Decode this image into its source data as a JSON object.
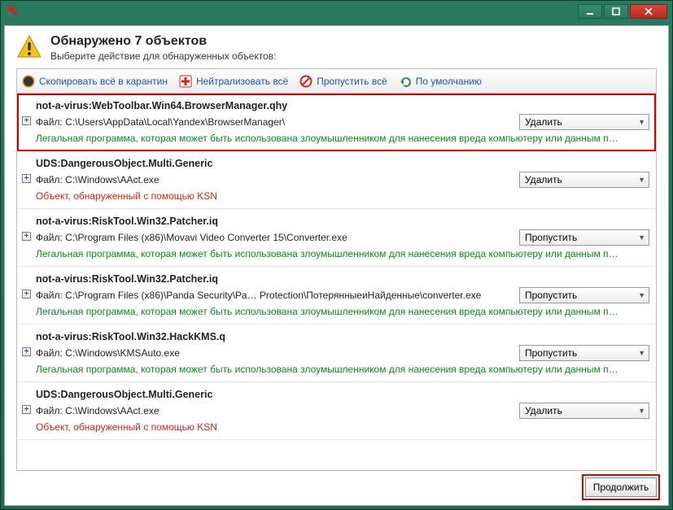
{
  "header": {
    "title": "Обнаружено 7 объектов",
    "subtitle": "Выберите действие для обнаруженных объектов:"
  },
  "toolbar": {
    "quarantine": "Скопировать всё в карантин",
    "neutralize": "Нейтрализовать всё",
    "skip": "Пропустить всё",
    "default": "По умолчанию"
  },
  "labels": {
    "file_prefix": "Файл: "
  },
  "items": [
    {
      "name": "not-a-virus:WebToolbar.Win64.BrowserManager.qhy",
      "path": "C:\\Users\\AppData\\Local\\Yandex\\BrowserManager\\",
      "action": "Удалить",
      "desc": "Легальная программа, которая может быть использована злоумышленником для нанесения вреда компьютеру или данным п…",
      "desc_color": "green",
      "highlight": true
    },
    {
      "name": "UDS:DangerousObject.Multi.Generic",
      "path": "C:\\Windows\\AAct.exe",
      "action": "Удалить",
      "desc": "Объект, обнаруженный с помощью KSN",
      "desc_color": "red",
      "highlight": false
    },
    {
      "name": "not-a-virus:RiskTool.Win32.Patcher.iq",
      "path": "C:\\Program Files (x86)\\Movavi Video Converter 15\\Converter.exe",
      "action": "Пропустить",
      "desc": "Легальная программа, которая может быть использована злоумышленником для нанесения вреда компьютеру или данным п…",
      "desc_color": "green",
      "highlight": false
    },
    {
      "name": "not-a-virus:RiskTool.Win32.Patcher.iq",
      "path": "C:\\Program Files (x86)\\Panda Security\\Pa… Protection\\ПотерянныеиНайденные\\converter.exe",
      "action": "Пропустить",
      "desc": "Легальная программа, которая может быть использована злоумышленником для нанесения вреда компьютеру или данным п…",
      "desc_color": "green",
      "highlight": false
    },
    {
      "name": "not-a-virus:RiskTool.Win32.HackKMS.q",
      "path": "C:\\Windows\\KMSAuto.exe",
      "action": "Пропустить",
      "desc": "Легальная программа, которая может быть использована злоумышленником для нанесения вреда компьютеру или данным п…",
      "desc_color": "green",
      "highlight": false
    },
    {
      "name": "UDS:DangerousObject.Multi.Generic",
      "path": "C:\\Windows\\AAct.exe",
      "action": "Удалить",
      "desc": "Объект, обнаруженный с помощью KSN",
      "desc_color": "red",
      "highlight": false
    }
  ],
  "footer": {
    "continue": "Продолжить"
  }
}
